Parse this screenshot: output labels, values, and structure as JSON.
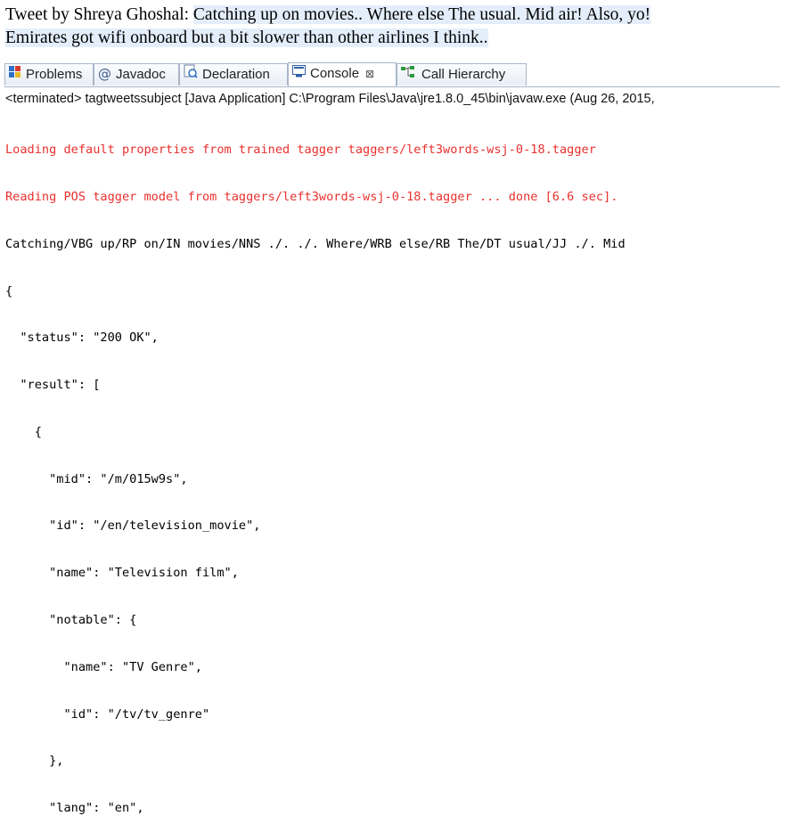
{
  "tweet": {
    "author_label": "Tweet by Shreya Ghoshal:",
    "line1_text": "Catching up on movies.. Where else The usual. Mid air! Also, yo!",
    "line2_text": "Emirates got wifi onboard but a bit slower than other airlines I think.."
  },
  "tabs": [
    {
      "label": "Problems",
      "icon": "problems-icon"
    },
    {
      "label": "Javadoc",
      "icon": "javadoc-icon"
    },
    {
      "label": "Declaration",
      "icon": "declaration-icon"
    },
    {
      "label": "Console",
      "icon": "console-icon",
      "active": true,
      "close": "⊠"
    },
    {
      "label": "Call Hierarchy",
      "icon": "call-hierarchy-icon"
    }
  ],
  "terminated_label": "<terminated> tagtweetssubject [Java Application] C:\\Program Files\\Java\\jre1.8.0_45\\bin\\javaw.exe (Aug 26, 2015,",
  "console": {
    "error_lines": [
      "Loading default properties from trained tagger taggers/left3words-wsj-0-18.tagger",
      "Reading POS tagger model from taggers/left3words-wsj-0-18.tagger ... done [6.6 sec]."
    ],
    "output_lines": [
      "Catching/VBG up/RP on/IN movies/NNS ./. ./. Where/WRB else/RB The/DT usual/JJ ./. Mid",
      "{",
      "  \"status\": \"200 OK\",",
      "  \"result\": [",
      "    {",
      "      \"mid\": \"/m/015w9s\",",
      "      \"id\": \"/en/television_movie\",",
      "      \"name\": \"Television film\",",
      "      \"notable\": {",
      "        \"name\": \"TV Genre\",",
      "        \"id\": \"/tv/tv_genre\"",
      "      },",
      "      \"lang\": \"en\","
    ]
  },
  "colors": {
    "error_text": "#e8312e",
    "highlight": "#e4eefb",
    "tab_border": "#a9b6c8"
  }
}
